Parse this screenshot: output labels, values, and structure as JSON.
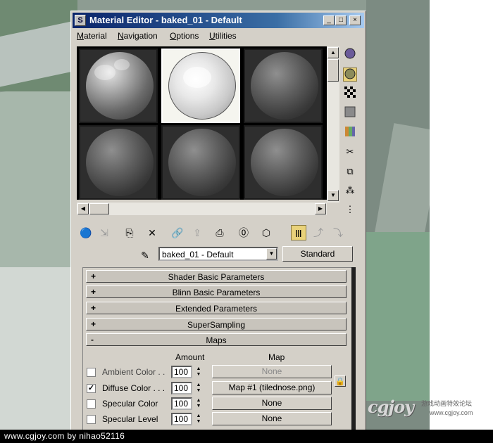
{
  "window": {
    "title": "Material Editor - baked_01 - Default",
    "minimize_glyph": "_",
    "maximize_glyph": "□",
    "close_glyph": "×"
  },
  "menubar": {
    "items": [
      {
        "first": "M",
        "rest": "aterial"
      },
      {
        "first": "N",
        "rest": "avigation"
      },
      {
        "first": "O",
        "rest": "ptions"
      },
      {
        "first": "U",
        "rest": "tilities"
      }
    ]
  },
  "name_row": {
    "material_name": "baked_01 - Default",
    "type_button": "Standard"
  },
  "rollouts": [
    {
      "sign": "+",
      "title": "Shader Basic Parameters"
    },
    {
      "sign": "+",
      "title": "Blinn Basic Parameters"
    },
    {
      "sign": "+",
      "title": "Extended Parameters"
    },
    {
      "sign": "+",
      "title": "SuperSampling"
    },
    {
      "sign": "-",
      "title": "Maps"
    }
  ],
  "maps": {
    "amount_header": "Amount",
    "map_header": "Map",
    "rows": [
      {
        "name": "Ambient Color . .",
        "checked": false,
        "amount": "100",
        "map": "None",
        "dim": true
      },
      {
        "name": "Diffuse Color . . .",
        "checked": true,
        "amount": "100",
        "map": "Map #1 (tilednose.png)",
        "dim": false
      },
      {
        "name": "Specular Color",
        "checked": false,
        "amount": "100",
        "map": "None",
        "dim": false
      },
      {
        "name": "Specular Level",
        "checked": false,
        "amount": "100",
        "map": "None",
        "dim": false
      }
    ]
  },
  "footer": {
    "text": "www.cgjoy.com by nihao52116"
  },
  "watermark": {
    "logo": "cgjoy",
    "slogan": "游戏动画特效论坛",
    "url": "www.cgjoy.com"
  }
}
